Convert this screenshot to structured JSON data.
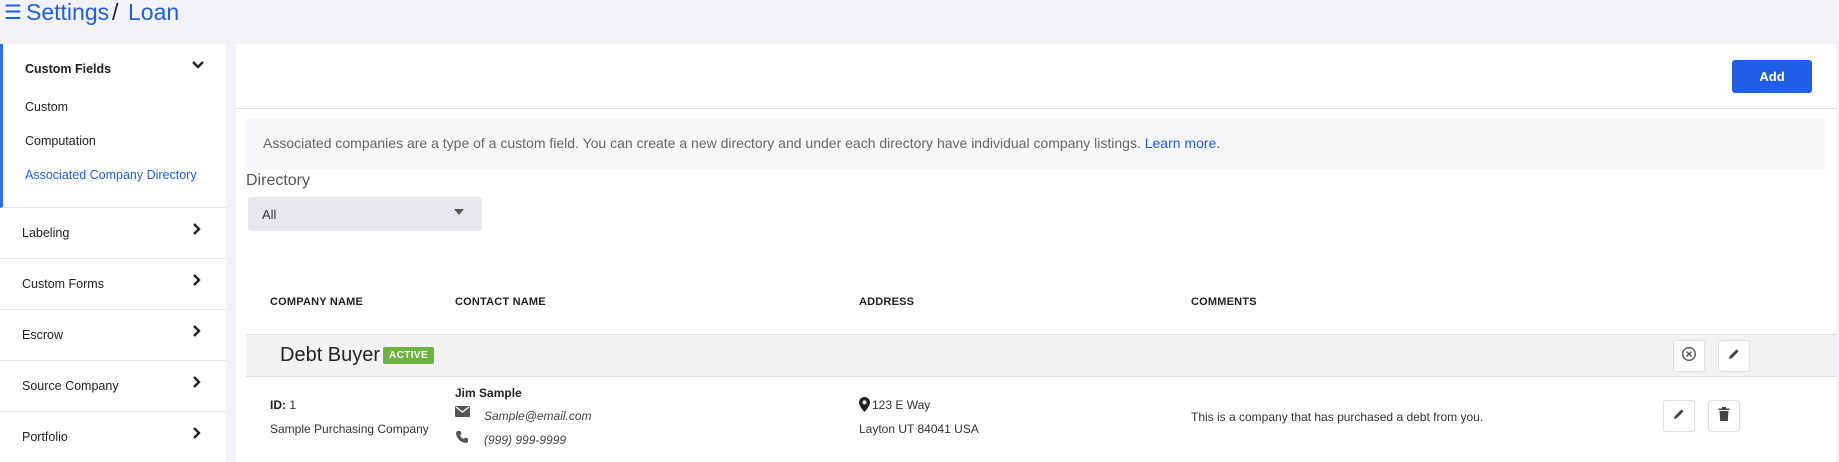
{
  "breadcrumb": {
    "root": "Settings",
    "separator": "/",
    "current": "Loan"
  },
  "sidebar": {
    "custom_fields": {
      "title": "Custom Fields",
      "items": [
        "Custom",
        "Computation",
        "Associated Company Directory"
      ],
      "active_item": "Associated Company Directory"
    },
    "sections": [
      "Labeling",
      "Custom Forms",
      "Escrow",
      "Source Company",
      "Portfolio"
    ]
  },
  "toolbar": {
    "add_label": "Add"
  },
  "info": {
    "text": "Associated companies are a type of a custom field. You can create a new directory and under each directory have individual company listings.",
    "link": "Learn more."
  },
  "directory": {
    "label": "Directory",
    "selected": "All"
  },
  "table": {
    "headers": [
      "COMPANY NAME",
      "CONTACT NAME",
      "ADDRESS",
      "COMMENTS"
    ],
    "group": {
      "name": "Debt Buyer",
      "status": "ACTIVE"
    },
    "rows": [
      {
        "id_label": "ID:",
        "id": "1",
        "company": "Sample Purchasing Company",
        "contact_name": "Jim Sample",
        "email": "Sample@email.com",
        "phone": "(999) 999-9999",
        "address_line1": "123 E Way",
        "address_line2": "Layton UT 84041 USA",
        "comments": "This is a company that has purchased a debt from you."
      }
    ]
  },
  "colors": {
    "accent": "#1f5fe8",
    "active_badge": "#6cb33f"
  },
  "icons": [
    "menu-icon",
    "chevron-down-icon",
    "chevron-right-icon",
    "cancel-circle-icon",
    "pencil-icon",
    "trash-icon",
    "envelope-icon",
    "phone-icon",
    "map-pin-icon"
  ]
}
